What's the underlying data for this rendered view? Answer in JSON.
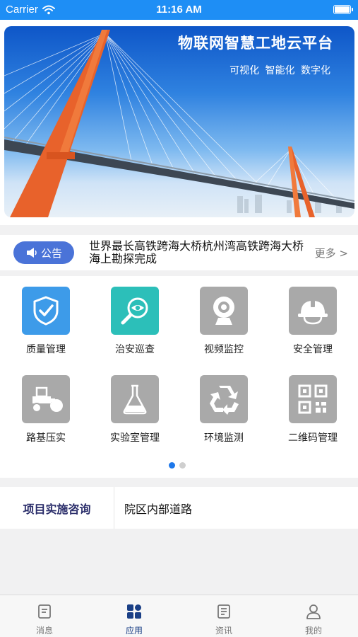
{
  "status_bar": {
    "carrier": "Carrier",
    "time": "11:16 AM"
  },
  "banner": {
    "title": "物联网智慧工地云平台",
    "subtitle": "可视化 智能化 数字化"
  },
  "notice": {
    "badge": "公告",
    "text": "世界最长高铁跨海大桥杭州湾高铁跨海大桥海上勘探完成",
    "more": "更多 >"
  },
  "apps": [
    {
      "label": "质量管理",
      "icon": "shield-check-icon",
      "color": "#3d9be9"
    },
    {
      "label": "治安巡查",
      "icon": "magnifier-eye-icon",
      "color": "#2cbfb9"
    },
    {
      "label": "视频监控",
      "icon": "webcam-icon",
      "color": "#a9a9a9"
    },
    {
      "label": "安全管理",
      "icon": "hardhat-icon",
      "color": "#a9a9a9"
    },
    {
      "label": "路基压实",
      "icon": "road-roller-icon",
      "color": "#a9a9a9"
    },
    {
      "label": "实验室管理",
      "icon": "flask-icon",
      "color": "#a9a9a9"
    },
    {
      "label": "环境监测",
      "icon": "recycle-icon",
      "color": "#a9a9a9"
    },
    {
      "label": "二维码管理",
      "icon": "qr-code-icon",
      "color": "#a9a9a9"
    }
  ],
  "pager": {
    "pages": 2,
    "active": 1
  },
  "consult": {
    "label": "项目实施咨询",
    "value": "院区内部道路"
  },
  "tabs": [
    {
      "label": "消息",
      "icon": "message-doc-icon",
      "active": false
    },
    {
      "label": "应用",
      "icon": "apps-grid-icon",
      "active": true
    },
    {
      "label": "资讯",
      "icon": "news-doc-icon",
      "active": false
    },
    {
      "label": "我的",
      "icon": "user-icon",
      "active": false
    }
  ],
  "colors": {
    "status_bar": "#1e8ef5",
    "notice_badge": "#4a73d8",
    "active_tab": "#1a3f86",
    "pager_active": "#1e78ea"
  }
}
